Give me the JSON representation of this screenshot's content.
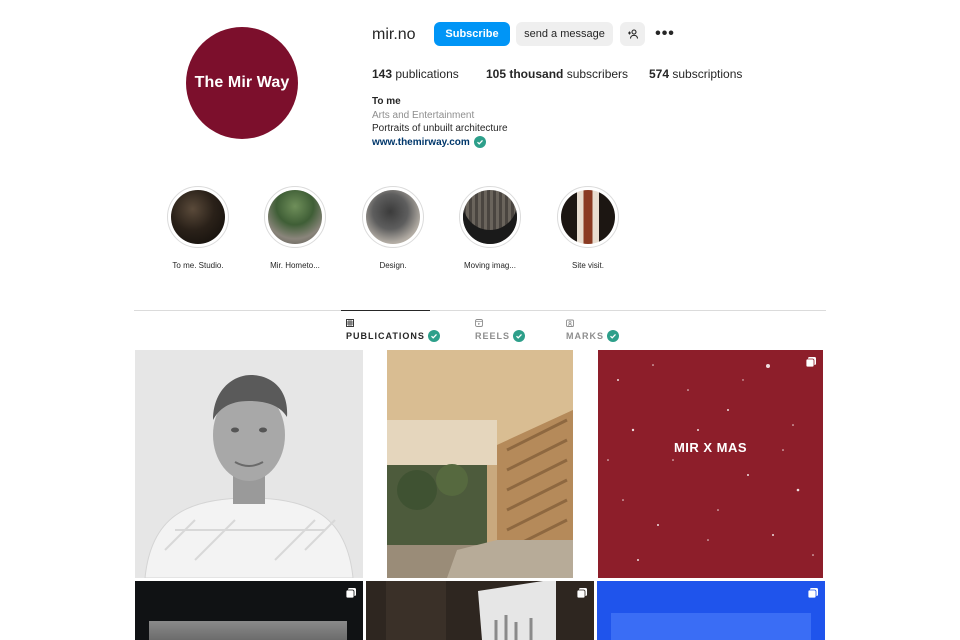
{
  "profile": {
    "username": "mir.no",
    "avatar_text": "The Mir Way",
    "buttons": {
      "subscribe": "Subscribe",
      "message": "send a message"
    },
    "stats": [
      {
        "value": "143",
        "label": "publications"
      },
      {
        "value": "105 thousand",
        "label": "subscribers"
      },
      {
        "value": "574",
        "label": "subscriptions"
      }
    ],
    "bio": {
      "name": "To me",
      "category": "Arts and Entertainment",
      "description": "Portraits of unbuilt architecture",
      "link": "www.themirway.com"
    }
  },
  "highlights": [
    {
      "label": "To me. Studio."
    },
    {
      "label": "Mir. Hometo..."
    },
    {
      "label": "Design."
    },
    {
      "label": "Moving imag..."
    },
    {
      "label": "Site visit."
    }
  ],
  "tabs": [
    {
      "label": "PUBLICATIONS",
      "active": true
    },
    {
      "label": "REELS",
      "active": false
    },
    {
      "label": "MARKS",
      "active": false
    }
  ],
  "posts": [
    {
      "caption": ""
    },
    {
      "caption": ""
    },
    {
      "caption": "MIR X MAS"
    }
  ],
  "colors": {
    "brand": "#7c0f2c",
    "subscribe": "#0095f6",
    "verified": "#2d9f8a",
    "link": "#00376b"
  },
  "icons": [
    "user-plus-icon",
    "more-icon",
    "verified-icon",
    "grid-icon",
    "reels-icon",
    "tag-icon",
    "multi-post-icon"
  ]
}
